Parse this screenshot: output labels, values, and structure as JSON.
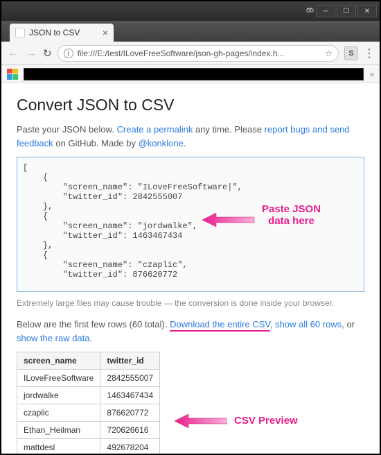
{
  "browser": {
    "tab_title": "JSON to CSV",
    "url": "file:///E:/test/ILoveFreeSoftware/json-gh-pages/index.h...",
    "ext_label": "S"
  },
  "page": {
    "heading": "Convert JSON to CSV",
    "intro_prefix": "Paste your JSON below. ",
    "permalink": "Create a permalink",
    "intro_mid": " any time. Please ",
    "report": "report bugs and send feedback",
    "intro_mid2": " on GitHub. Made by ",
    "author": "@konklone",
    "intro_suffix": ".",
    "json_text": "[\n    {\n        \"screen_name\": \"ILoveFreeSoftware|\",\n        \"twitter_id\": 2842555007\n    },\n    {\n        \"screen_name\": \"jordwalke\",\n        \"twitter_id\": 1463467434\n    },\n    {\n        \"screen_name\": \"czaplic\",\n        \"twitter_id\": 876620772\n",
    "hint": "Extremely large files may cause trouble — the conversion is done inside your browser.",
    "below_prefix": "Below are the first few rows (60 total). ",
    "download": "Download the entire CSV",
    "below_sep": ", ",
    "showall": "show all 60 rows",
    "below_sep2": ", or ",
    "showraw": "show the raw data",
    "below_suffix": ".",
    "table": {
      "headers": [
        "screen_name",
        "twitter_id"
      ],
      "rows": [
        [
          "ILoveFreeSoftware",
          "2842555007"
        ],
        [
          "jordwalke",
          "1463467434"
        ],
        [
          "czaplic",
          "876620772"
        ],
        [
          "Ethan_Heilman",
          "720626616"
        ],
        [
          "mattdesl",
          "492678204"
        ]
      ]
    }
  },
  "annotations": {
    "paste_l1": "Paste JSON",
    "paste_l2": "data here",
    "preview": "CSV Preview"
  }
}
